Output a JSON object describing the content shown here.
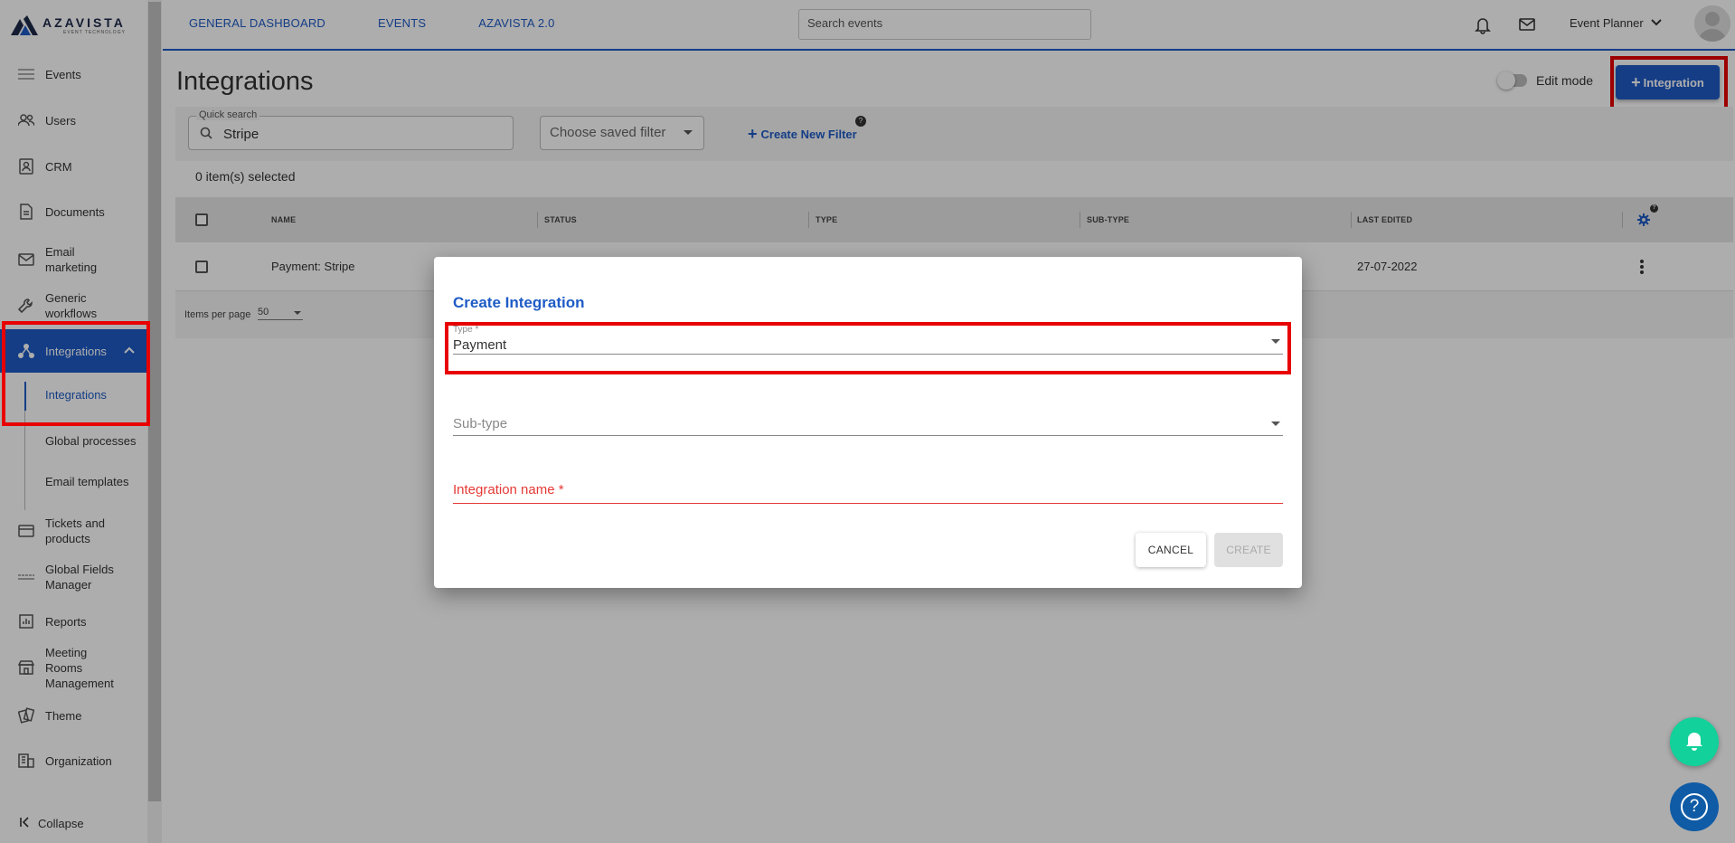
{
  "brand": {
    "name": "AZAVISTA",
    "tagline": "EVENT TECHNOLOGY"
  },
  "sidebar": {
    "items": [
      {
        "label": "Events",
        "icon": "list-icon"
      },
      {
        "label": "Users",
        "icon": "users-icon"
      },
      {
        "label": "CRM",
        "icon": "contact-card-icon"
      },
      {
        "label": "Documents",
        "icon": "document-icon"
      },
      {
        "label": "Email marketing",
        "icon": "mail-icon"
      },
      {
        "label": "Generic workflows",
        "icon": "wrench-icon"
      },
      {
        "label": "Integrations",
        "icon": "integration-icon",
        "active": true
      },
      {
        "label": "Tickets and products",
        "icon": "ticket-icon"
      },
      {
        "label": "Global Fields Manager",
        "icon": "fields-icon"
      },
      {
        "label": "Reports",
        "icon": "chart-icon"
      },
      {
        "label": "Meeting Rooms Management",
        "icon": "rooms-icon"
      },
      {
        "label": "Theme",
        "icon": "theme-icon"
      },
      {
        "label": "Organization",
        "icon": "organization-icon"
      }
    ],
    "subitems": [
      {
        "label": "Integrations",
        "active": true
      },
      {
        "label": "Global processes"
      },
      {
        "label": "Email templates"
      }
    ],
    "collapse_label": "Collapse"
  },
  "topbar": {
    "nav": [
      "GENERAL DASHBOARD",
      "EVENTS",
      "AZAVISTA 2.0"
    ],
    "search_placeholder": "Search events",
    "user_role": "Event Planner"
  },
  "page": {
    "title": "Integrations",
    "edit_mode_label": "Edit mode",
    "add_button_label": "Integration"
  },
  "filters": {
    "quick_search_label": "Quick search",
    "quick_search_value": "Stripe",
    "saved_filter_placeholder": "Choose saved filter",
    "create_filter_label": "Create New Filter",
    "help_glyph": "?"
  },
  "selection": {
    "count_text": "0 item(s) selected"
  },
  "table": {
    "columns": [
      "NAME",
      "STATUS",
      "TYPE",
      "SUB-TYPE",
      "LAST EDITED"
    ],
    "rows": [
      {
        "name": "Payment: Stripe",
        "status": "",
        "type": "",
        "subtype": "",
        "last_edited": "27-07-2022"
      }
    ],
    "items_per_page_label": "Items per page",
    "items_per_page_value": "50"
  },
  "dialog": {
    "title": "Create Integration",
    "type_label": "Type *",
    "type_value": "Payment",
    "subtype_placeholder": "Sub-type",
    "name_placeholder": "Integration name *",
    "cancel_label": "CANCEL",
    "create_label": "CREATE"
  },
  "colors": {
    "primary": "#1e5bc6",
    "highlight": "#e80000",
    "error": "#e53935",
    "notify_fab": "#12d19a",
    "help_fab": "#0f5ba6"
  }
}
